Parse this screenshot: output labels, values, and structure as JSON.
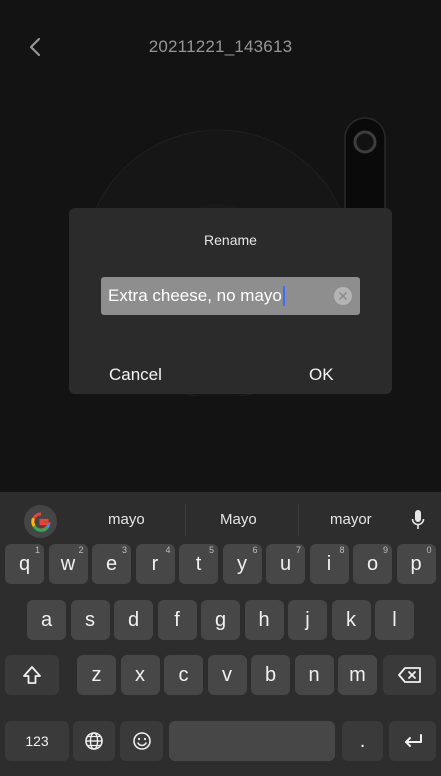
{
  "header": {
    "title": "20211221_143613"
  },
  "dialog": {
    "title": "Rename",
    "input_value": "Extra cheese, no mayo",
    "cancel_label": "Cancel",
    "ok_label": "OK"
  },
  "keyboard": {
    "suggestions": [
      "mayo",
      "Mayo",
      "mayor"
    ],
    "row1": [
      {
        "k": "q",
        "h": "1"
      },
      {
        "k": "w",
        "h": "2"
      },
      {
        "k": "e",
        "h": "3"
      },
      {
        "k": "r",
        "h": "4"
      },
      {
        "k": "t",
        "h": "5"
      },
      {
        "k": "y",
        "h": "6"
      },
      {
        "k": "u",
        "h": "7"
      },
      {
        "k": "i",
        "h": "8"
      },
      {
        "k": "o",
        "h": "9"
      },
      {
        "k": "p",
        "h": "0"
      }
    ],
    "row2": [
      "a",
      "s",
      "d",
      "f",
      "g",
      "h",
      "j",
      "k",
      "l"
    ],
    "row3": [
      "z",
      "x",
      "c",
      "v",
      "b",
      "n",
      "m"
    ],
    "numbers_label": "123",
    "period_label": "."
  },
  "colors": {
    "background": "#1b1b1b",
    "dialog": "#2b2b2b",
    "keyboard": "#2d2d2d",
    "key": "#474747",
    "caret": "#3b6cff"
  }
}
